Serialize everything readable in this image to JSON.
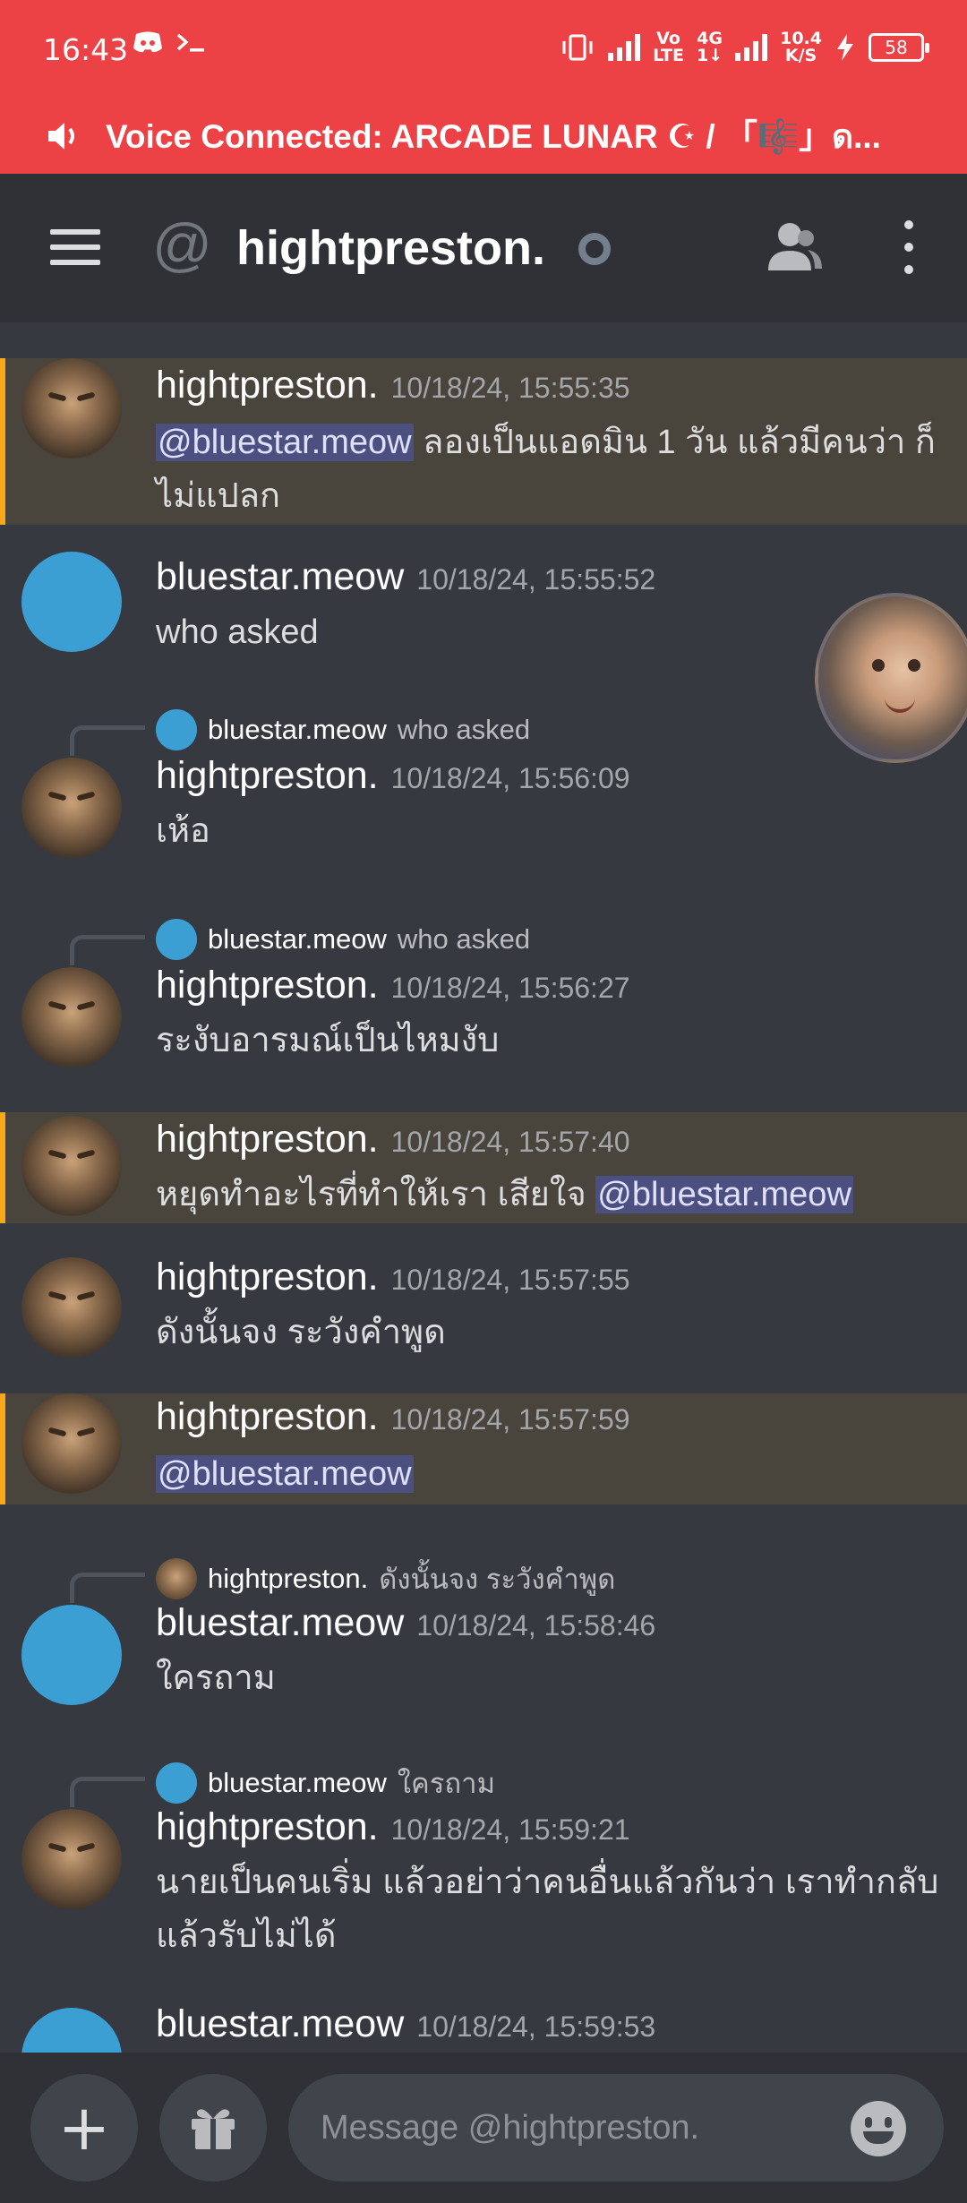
{
  "status_bar": {
    "time": "16:43",
    "net_type_top": "4G",
    "net_type_bottom": "1↓",
    "volte_top": "Vo",
    "volte_bottom": "LTE",
    "speed_top": "10.4",
    "speed_bottom": "K/S",
    "battery": "58"
  },
  "voice_bar": {
    "text": "Voice Connected: ARCADE LUNAR ☪ / 「🎼」ด..."
  },
  "header": {
    "title": "hightpreston."
  },
  "colors": {
    "status_red": "#ed4245",
    "mention_bg": "#49443c",
    "mention_accent": "#faa81a",
    "blue_avatar": "#3c9fd4",
    "chat_bg": "#36393f"
  },
  "messages": [
    {
      "author": "hightpreston.",
      "time": "10/18/24, 15:55:35",
      "mention": "@bluestar.meow",
      "text": " ลองเป็นแอดมิน 1 วัน แล้วมีคนว่า ก็ไม่แปลก"
    },
    {
      "author": "bluestar.meow",
      "time": "10/18/24, 15:55:52",
      "text": "who asked"
    },
    {
      "author": "hightpreston.",
      "time": "10/18/24, 15:56:09",
      "text": "เห้อ",
      "reply_name": "bluestar.meow",
      "reply_text": "who asked"
    },
    {
      "author": "hightpreston.",
      "time": "10/18/24, 15:56:27",
      "text": "ระงับอารมณ์เป็นไหมงับ",
      "reply_name": "bluestar.meow",
      "reply_text": "who asked"
    },
    {
      "author": "hightpreston.",
      "time": "10/18/24, 15:57:40",
      "text": "หยุดทำอะไรที่ทำให้เรา เสียใจ ",
      "mention": "@bluestar.meow"
    },
    {
      "author": "hightpreston.",
      "time": "10/18/24, 15:57:55",
      "text": "ดังนั้นจง ระวังคำพูด"
    },
    {
      "author": "hightpreston.",
      "time": "10/18/24, 15:57:59",
      "mention": "@bluestar.meow"
    },
    {
      "author": "bluestar.meow",
      "time": "10/18/24, 15:58:46",
      "text": "ใครถาม",
      "reply_name": "hightpreston.",
      "reply_text": "ดังนั้นจง ระวังคำพูด"
    },
    {
      "author": "hightpreston.",
      "time": "10/18/24, 15:59:21",
      "text": "นายเป็นคนเริ่ม แล้วอย่าว่าคนอื่นแล้วกันว่า เราทำกลับแล้วรับไม่ได้",
      "reply_name": "bluestar.meow",
      "reply_text": "ใครถาม"
    },
    {
      "author": "bluestar.meow",
      "time": "10/18/24, 15:59:53"
    }
  ],
  "composer": {
    "placeholder": "Message @hightpreston."
  }
}
